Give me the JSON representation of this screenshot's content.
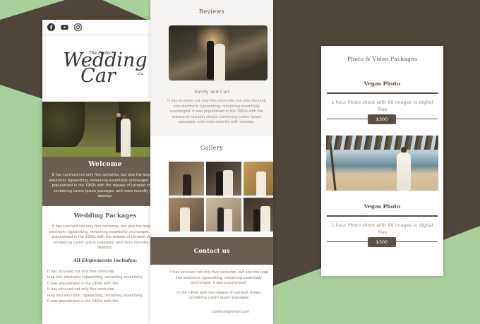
{
  "left_page": {
    "social_icons": [
      "facebook-icon",
      "youtube-icon",
      "instagram-icon"
    ],
    "menu_icon": "hamburger-menu-icon",
    "logo": {
      "line1": "The Perfect",
      "line2": "Wedding",
      "line3": "Car",
      "suffix": "Co."
    },
    "welcome": {
      "title": "Welcome",
      "text": "It has survived not only five centuries, but also the leap into electronic typesetting, remaining essentially unchanged. It was popularised in the 1960s with the release of Letraset sheets containing Lorem Ipsum passages, and more recently with desktop."
    },
    "packages": {
      "title": "Wedding Packages",
      "text": "It has survived not only five centuries, but also the leap into electronic typesetting, remaining essentially unchanged. It was popularised in the 1960s with the release of Letraset sheets containing Lorem Ipsum passages, and more recently with desktop.",
      "includes_title": "All Elopements includes:",
      "includes": [
        "It has survived not only five centuries",
        "leap into electronic typesetting, remaining essentially",
        "It was popularised in the 1960s with the.",
        "It has survived not only five centuries",
        "leap into electronic typesetting, remaining essentially",
        "It was popularised in the 1960s with the."
      ]
    }
  },
  "middle_page": {
    "reviews": {
      "title": "Reviews",
      "reviewer": "Sandy and Carl",
      "text": "It has survived not only five centuries, but also the leap into electronic typesetting, remaining essentially unchanged. It was popularised in the 1960s with the release of Letraset sheets containing Lorem Ipsum passages, and more recently with desktop."
    },
    "gallery": {
      "title": "Gallery"
    },
    "contact": {
      "title": "Contact us",
      "text1": "It has survived not only five centuries, but also the leap into electronic typesetting, remaining essentially unchanged. It was popularised?",
      "text2": "In the 1960s with the release of Letraset sheets containing Lorem Ipsum passages.",
      "email": "contacto@email.com"
    }
  },
  "right_card": {
    "title": "Photo & Video Packages",
    "packages": [
      {
        "name": "Vegas Photo",
        "desc": "1 hour Photo shoot  with 60 images in digital files",
        "price": "$300"
      },
      {
        "name": "Vegas Photo",
        "desc": "1 hour Photo shoot  with 60 images in digital files",
        "price": "$300"
      }
    ]
  },
  "colors": {
    "brand_brown": "#6a5e52",
    "dark_brown": "#4f463b",
    "accent_green": "#a9cf9b"
  }
}
